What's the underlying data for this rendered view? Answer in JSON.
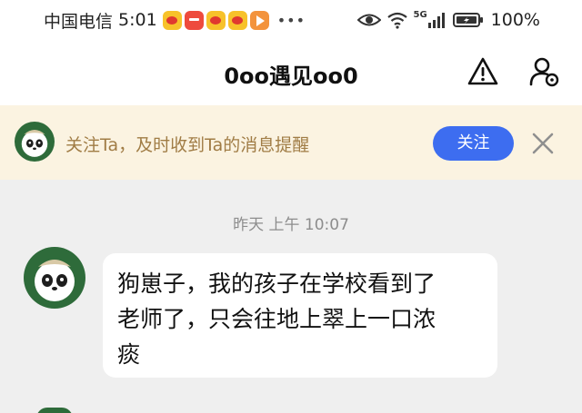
{
  "status_bar": {
    "carrier": "中国电信",
    "time": "5:01",
    "network": "5G",
    "battery": "100%",
    "notification_icons": [
      "weibo-icon",
      "huawei-store-icon",
      "weibo-icon",
      "weibo-icon",
      "video-app-icon"
    ]
  },
  "header": {
    "title": "0oo遇见oo0",
    "actions": [
      "warning-icon",
      "user-settings-icon"
    ]
  },
  "follow_banner": {
    "prompt": "关注Ta，及时收到Ta的消息提醒",
    "follow_label": "关注"
  },
  "chat": {
    "timestamp": "昨天 上午 10:07",
    "messages": [
      {
        "lines": [
          "狗崽子，我的孩子在学校看到了",
          "老师了，只会往地上翠上一口浓",
          "痰"
        ]
      }
    ]
  },
  "colors": {
    "accent_blue": "#3d6df0",
    "banner_bg": "#fbf3e1",
    "banner_text": "#a07c45",
    "avatar_green": "#2e6b3a",
    "chat_bg": "#efefef"
  }
}
